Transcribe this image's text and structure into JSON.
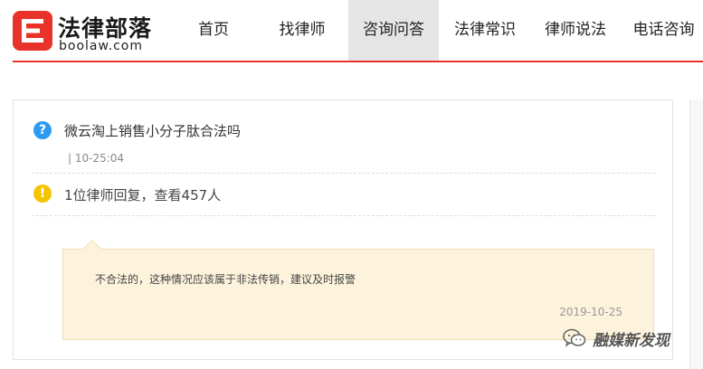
{
  "logo": {
    "cn": "法律部落",
    "en": "boolaw.com"
  },
  "nav": {
    "items": [
      {
        "label": "首页",
        "active": false
      },
      {
        "label": "找律师",
        "active": false
      },
      {
        "label": "咨询问答",
        "active": true
      },
      {
        "label": "法律常识",
        "active": false
      },
      {
        "label": "律师说法",
        "active": false
      },
      {
        "label": "电话咨询",
        "active": false
      }
    ]
  },
  "question": {
    "icon": "question-icon",
    "title": "微云淘上销售小分子肽合法吗",
    "time": "| 10-25:04"
  },
  "stats": {
    "icon": "exclamation-icon",
    "text": "1位律师回复，查看457人"
  },
  "answer": {
    "text": "不合法的，这种情况应该属于非法传销，建议及时报警",
    "date": "2019-10-25"
  },
  "watermark": {
    "icon": "wechat-icon",
    "text": "融媒新发现"
  },
  "colors": {
    "accent": "#e8332a",
    "question_icon": "#2b9af3",
    "info_icon": "#f5c400",
    "answer_bg": "#fdf3dc"
  }
}
